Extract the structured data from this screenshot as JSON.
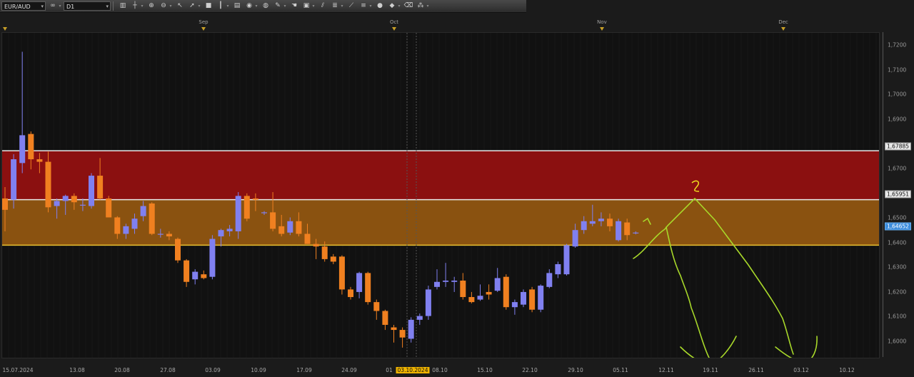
{
  "toolbar": {
    "symbol": "EUR/AUD",
    "timeframe": "D1",
    "icons": [
      "chart-type-icon",
      "crosshair-icon",
      "zoom-in-icon",
      "zoom-out-icon",
      "cursor-icon",
      "arrow-icon",
      "stop-icon",
      "vertical-line-icon",
      "note-icon",
      "camera-icon",
      "globe-icon",
      "pencil-icon",
      "hand-icon",
      "window-icon",
      "channel-icon",
      "fibonacci-icon",
      "fan-icon",
      "line-style-icon",
      "color-icon",
      "shape-icon",
      "eraser-icon",
      "indicators-icon"
    ]
  },
  "top_axis": {
    "months": [
      "Sep",
      "Oct",
      "Nov",
      "Dec"
    ]
  },
  "price_axis": {
    "ticks": [
      "1,7200",
      "1,7100",
      "1,7000",
      "1,6900",
      "1,6700",
      "1,6500",
      "1,6400",
      "1,6300",
      "1,6200",
      "1,6100",
      "1,6000"
    ],
    "tag_upper": "1,67885",
    "tag_middle": "1,65951",
    "tag_current": "1,64652"
  },
  "bottom_axis": {
    "dates": [
      "15.07.2024",
      "13.08",
      "20.08",
      "27.08",
      "03.09",
      "10.09",
      "17.09",
      "24.09",
      "01",
      "03.10.2024",
      "08.10",
      "15.10",
      "22.10",
      "29.10",
      "05.11",
      "12.11",
      "19.11",
      "26.11",
      "03.12",
      "10.12"
    ]
  },
  "zones": {
    "red_top": 1.67885,
    "red_bottom": 1.65951,
    "orange_bottom": 1.64152,
    "red_color": "#8b1010",
    "orange_color": "#8a5210"
  },
  "annotations": {
    "label_1": "1",
    "label_2": "2",
    "color": "#a8d82a"
  },
  "chart_data": {
    "type": "candlestick",
    "symbol": "EUR/AUD",
    "timeframe": "D1",
    "ylim": [
      1.597,
      1.7255
    ],
    "candles": [
      {
        "o": 1.66,
        "h": 1.6645,
        "l": 1.647,
        "c": 1.6555
      },
      {
        "o": 1.6595,
        "h": 1.6775,
        "l": 1.656,
        "c": 1.6755
      },
      {
        "o": 1.674,
        "h": 1.718,
        "l": 1.67,
        "c": 1.685
      },
      {
        "o": 1.6855,
        "h": 1.6865,
        "l": 1.6715,
        "c": 1.6755
      },
      {
        "o": 1.6755,
        "h": 1.678,
        "l": 1.67,
        "c": 1.6745
      },
      {
        "o": 1.6745,
        "h": 1.6785,
        "l": 1.6545,
        "c": 1.6565
      },
      {
        "o": 1.657,
        "h": 1.66,
        "l": 1.652,
        "c": 1.659
      },
      {
        "o": 1.659,
        "h": 1.6615,
        "l": 1.6535,
        "c": 1.661
      },
      {
        "o": 1.661,
        "h": 1.662,
        "l": 1.6555,
        "c": 1.6585
      },
      {
        "o": 1.6575,
        "h": 1.66,
        "l": 1.655,
        "c": 1.6575
      },
      {
        "o": 1.657,
        "h": 1.67,
        "l": 1.656,
        "c": 1.669
      },
      {
        "o": 1.669,
        "h": 1.676,
        "l": 1.6595,
        "c": 1.66
      },
      {
        "o": 1.66,
        "h": 1.661,
        "l": 1.6525,
        "c": 1.6525
      },
      {
        "o": 1.6525,
        "h": 1.653,
        "l": 1.644,
        "c": 1.646
      },
      {
        "o": 1.646,
        "h": 1.65,
        "l": 1.644,
        "c": 1.649
      },
      {
        "o": 1.648,
        "h": 1.654,
        "l": 1.646,
        "c": 1.652
      },
      {
        "o": 1.653,
        "h": 1.659,
        "l": 1.651,
        "c": 1.657
      },
      {
        "o": 1.658,
        "h": 1.6585,
        "l": 1.6455,
        "c": 1.646
      },
      {
        "o": 1.646,
        "h": 1.648,
        "l": 1.6445,
        "c": 1.646
      },
      {
        "o": 1.646,
        "h": 1.647,
        "l": 1.6435,
        "c": 1.645
      },
      {
        "o": 1.644,
        "h": 1.6445,
        "l": 1.6345,
        "c": 1.6355
      },
      {
        "o": 1.6355,
        "h": 1.636,
        "l": 1.625,
        "c": 1.627
      },
      {
        "o": 1.628,
        "h": 1.632,
        "l": 1.626,
        "c": 1.631
      },
      {
        "o": 1.63,
        "h": 1.6315,
        "l": 1.628,
        "c": 1.6285
      },
      {
        "o": 1.629,
        "h": 1.6455,
        "l": 1.628,
        "c": 1.644
      },
      {
        "o": 1.645,
        "h": 1.648,
        "l": 1.641,
        "c": 1.6475
      },
      {
        "o": 1.647,
        "h": 1.6495,
        "l": 1.645,
        "c": 1.648
      },
      {
        "o": 1.647,
        "h": 1.6625,
        "l": 1.644,
        "c": 1.661
      },
      {
        "o": 1.661,
        "h": 1.662,
        "l": 1.651,
        "c": 1.652
      },
      {
        "o": 1.66,
        "h": 1.662,
        "l": 1.655,
        "c": 1.6595
      },
      {
        "o": 1.6545,
        "h": 1.655,
        "l": 1.6535,
        "c": 1.6545
      },
      {
        "o": 1.6545,
        "h": 1.6625,
        "l": 1.647,
        "c": 1.648
      },
      {
        "o": 1.649,
        "h": 1.6535,
        "l": 1.645,
        "c": 1.646
      },
      {
        "o": 1.6465,
        "h": 1.6525,
        "l": 1.6455,
        "c": 1.651
      },
      {
        "o": 1.651,
        "h": 1.6545,
        "l": 1.645,
        "c": 1.646
      },
      {
        "o": 1.646,
        "h": 1.65,
        "l": 1.642,
        "c": 1.642
      },
      {
        "o": 1.642,
        "h": 1.644,
        "l": 1.636,
        "c": 1.641
      },
      {
        "o": 1.641,
        "h": 1.643,
        "l": 1.635,
        "c": 1.636
      },
      {
        "o": 1.637,
        "h": 1.638,
        "l": 1.634,
        "c": 1.635
      },
      {
        "o": 1.637,
        "h": 1.6375,
        "l": 1.622,
        "c": 1.624
      },
      {
        "o": 1.624,
        "h": 1.625,
        "l": 1.62,
        "c": 1.621
      },
      {
        "o": 1.623,
        "h": 1.631,
        "l": 1.6205,
        "c": 1.6305
      },
      {
        "o": 1.6305,
        "h": 1.631,
        "l": 1.618,
        "c": 1.619
      },
      {
        "o": 1.619,
        "h": 1.62,
        "l": 1.612,
        "c": 1.6155
      },
      {
        "o": 1.6155,
        "h": 1.616,
        "l": 1.608,
        "c": 1.61
      },
      {
        "o": 1.609,
        "h": 1.61,
        "l": 1.603,
        "c": 1.608
      },
      {
        "o": 1.608,
        "h": 1.609,
        "l": 1.601,
        "c": 1.605
      },
      {
        "o": 1.6045,
        "h": 1.613,
        "l": 1.603,
        "c": 1.612
      },
      {
        "o": 1.612,
        "h": 1.6145,
        "l": 1.61,
        "c": 1.6135
      },
      {
        "o": 1.6135,
        "h": 1.6255,
        "l": 1.612,
        "c": 1.624
      },
      {
        "o": 1.625,
        "h": 1.632,
        "l": 1.624,
        "c": 1.627
      },
      {
        "o": 1.627,
        "h": 1.6345,
        "l": 1.625,
        "c": 1.6275
      },
      {
        "o": 1.627,
        "h": 1.629,
        "l": 1.623,
        "c": 1.6275
      },
      {
        "o": 1.6275,
        "h": 1.6305,
        "l": 1.62,
        "c": 1.621
      },
      {
        "o": 1.621,
        "h": 1.623,
        "l": 1.6185,
        "c": 1.619
      },
      {
        "o": 1.62,
        "h": 1.626,
        "l": 1.6195,
        "c": 1.6215
      },
      {
        "o": 1.623,
        "h": 1.626,
        "l": 1.62,
        "c": 1.622
      },
      {
        "o": 1.6235,
        "h": 1.6325,
        "l": 1.623,
        "c": 1.6285
      },
      {
        "o": 1.629,
        "h": 1.63,
        "l": 1.616,
        "c": 1.617
      },
      {
        "o": 1.617,
        "h": 1.62,
        "l": 1.614,
        "c": 1.619
      },
      {
        "o": 1.618,
        "h": 1.624,
        "l": 1.617,
        "c": 1.623
      },
      {
        "o": 1.624,
        "h": 1.625,
        "l": 1.615,
        "c": 1.616
      },
      {
        "o": 1.616,
        "h": 1.626,
        "l": 1.615,
        "c": 1.6255
      },
      {
        "o": 1.625,
        "h": 1.632,
        "l": 1.6245,
        "c": 1.6305
      },
      {
        "o": 1.63,
        "h": 1.635,
        "l": 1.6285,
        "c": 1.634
      },
      {
        "o": 1.63,
        "h": 1.642,
        "l": 1.6295,
        "c": 1.6415
      },
      {
        "o": 1.641,
        "h": 1.65,
        "l": 1.6405,
        "c": 1.6475
      },
      {
        "o": 1.6475,
        "h": 1.653,
        "l": 1.646,
        "c": 1.651
      },
      {
        "o": 1.65,
        "h": 1.6575,
        "l": 1.649,
        "c": 1.651
      },
      {
        "o": 1.651,
        "h": 1.6545,
        "l": 1.649,
        "c": 1.652
      },
      {
        "o": 1.652,
        "h": 1.654,
        "l": 1.647,
        "c": 1.649
      },
      {
        "o": 1.6435,
        "h": 1.652,
        "l": 1.643,
        "c": 1.651
      },
      {
        "o": 1.6505,
        "h": 1.652,
        "l": 1.6435,
        "c": 1.6455
      },
      {
        "o": 1.6462,
        "h": 1.647,
        "l": 1.6458,
        "c": 1.6465
      }
    ]
  }
}
